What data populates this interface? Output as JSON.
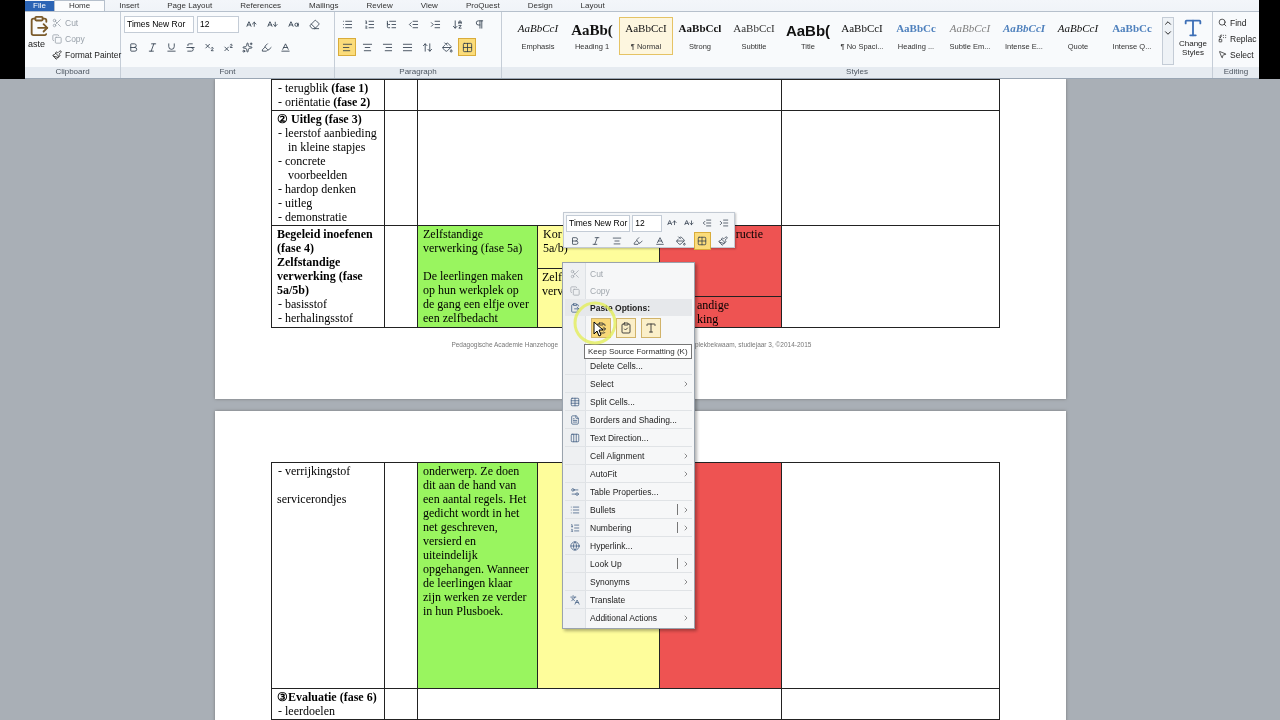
{
  "ribbon": {
    "tabs": [
      {
        "label": "File",
        "selected": false,
        "kind": "file"
      },
      {
        "label": "Home",
        "selected": true,
        "kind": "tab"
      },
      {
        "label": "Insert",
        "selected": false,
        "kind": "tab"
      },
      {
        "label": "Page Layout",
        "selected": false,
        "kind": "tab"
      },
      {
        "label": "References",
        "selected": false,
        "kind": "tab"
      },
      {
        "label": "Mailings",
        "selected": false,
        "kind": "tab"
      },
      {
        "label": "Review",
        "selected": false,
        "kind": "tab"
      },
      {
        "label": "View",
        "selected": false,
        "kind": "tab"
      },
      {
        "label": "ProQuest",
        "selected": false,
        "kind": "tab"
      },
      {
        "label": "Design",
        "selected": false,
        "kind": "tab"
      },
      {
        "label": "Layout",
        "selected": false,
        "kind": "tab"
      }
    ],
    "clipboard": {
      "label": "Clipboard",
      "paste": "aste",
      "items": [
        {
          "label": "Cut",
          "disabled": true
        },
        {
          "label": "Copy",
          "disabled": true
        },
        {
          "label": "Format Painter",
          "disabled": false
        }
      ]
    },
    "font": {
      "label": "Font",
      "font_name": "Times New Ror",
      "font_size": "12"
    },
    "paragraph": {
      "label": "Paragraph",
      "align_buttons": [
        {
          "selected": true
        },
        {
          "selected": false
        },
        {
          "selected": false
        },
        {
          "selected": false
        }
      ],
      "borders_active": true
    },
    "styles": {
      "label": "Styles",
      "items": [
        {
          "preview": "AaBbCcI",
          "name": "Emphasis",
          "kind": "emphasis",
          "selected": false
        },
        {
          "preview": "AaBb(",
          "name": "Heading 1",
          "kind": "heading",
          "selected": false
        },
        {
          "preview": "AaBbCcI",
          "name": "¶ Normal",
          "kind": "normal",
          "selected": true
        },
        {
          "preview": "AaBbCcl",
          "name": "Strong",
          "kind": "strong",
          "selected": false
        },
        {
          "preview": "AaBbCcI",
          "name": "Subtitle",
          "kind": "subtitle",
          "selected": false
        },
        {
          "preview": "AaBb(",
          "name": "Title",
          "kind": "title",
          "selected": false
        },
        {
          "preview": "AaBbCcI",
          "name": "¶ No Spaci...",
          "kind": "normal",
          "selected": false
        },
        {
          "preview": "AaBbCc",
          "name": "Heading ...",
          "kind": "heading2",
          "selected": false
        },
        {
          "preview": "AaBbCcI",
          "name": "Subtle Em...",
          "kind": "subtle",
          "selected": false
        },
        {
          "preview": "AaBbCcI",
          "name": "Intense E...",
          "kind": "intense",
          "selected": false
        },
        {
          "preview": "AaBbCcI",
          "name": "Quote",
          "kind": "emphasis",
          "selected": false
        },
        {
          "preview": "AaBbCc",
          "name": "Intense Q...",
          "kind": "heading2",
          "selected": false
        }
      ],
      "change_styles": [
        "Change",
        "Styles"
      ]
    },
    "editing": {
      "label": "Editing",
      "items": [
        "Find",
        "Replac",
        "Select"
      ]
    }
  },
  "pages": [
    {
      "footer": [
        "Pedagogische Academie Hanzehoge",
        "plekbekwaam, studiejaar 3, ©2014-2015"
      ],
      "rows": [
        {
          "cells": [
            {
              "paragraphs": [
                {
                  "text": "- terugblik **(fase 1)**",
                  "kind": "bullet",
                  "bold": false
                },
                {
                  "text": "- oriëntatie **(fase 2)**",
                  "kind": "bullet",
                  "bold": false
                }
              ]
            },
            {},
            {},
            {}
          ]
        },
        {
          "cells": [
            {
              "paragraphs": [
                {
                  "text": "② Uitleg (fase 3)",
                  "kind": "plain",
                  "bold": true
                },
                {
                  "text": "- leerstof aanbieding in kleine stapjes",
                  "kind": "bullet",
                  "bold": false
                },
                {
                  "text": "- concrete voorbeelden",
                  "kind": "bullet",
                  "bold": false
                },
                {
                  "text": "- hardop denken",
                  "kind": "bullet",
                  "bold": false
                },
                {
                  "text": "- uitleg",
                  "kind": "bullet",
                  "bold": false
                },
                {
                  "text": "- demonstratie",
                  "kind": "bullet",
                  "bold": false
                }
              ]
            },
            {},
            {},
            {}
          ]
        },
        {
          "cells": [
            {
              "paragraphs": [
                {
                  "text": "Begeleid inoefenen (fase 4)",
                  "kind": "plain",
                  "bold": true
                },
                {
                  "text": "Zelfstandige verwerking (fase 5a/5b)",
                  "kind": "plain",
                  "bold": true
                },
                {
                  "text": "- basisstof",
                  "kind": "bullet",
                  "bold": false
                },
                {
                  "text": "- herhalingsstof",
                  "kind": "bullet",
                  "bold": false
                }
              ]
            },
            {},
            {
              "color": "#99f55f",
              "paragraphs": [
                {
                  "text": "Zelfstandige verwerking (fase 5a)",
                  "kind": "plain",
                  "bold": false
                },
                {
                  "text": "De leerlingen maken op hun werkplek op de gang een elfje over een zelfbedacht",
                  "kind": "spaced",
                  "bold": false
                }
              ]
            },
            {
              "color": "#fefd9b",
              "parts": [
                {
                  "paragraphs": [
                    {
                      "text": "Kor",
                      "bold": false
                    },
                    {
                      "text": "5a/b)",
                      "bold": false
                    }
                  ]
                },
                {
                  "paragraphs": [
                    {
                      "text": "Zelf",
                      "bold": false
                    },
                    {
                      "text": "verv",
                      "bold": false
                    }
                  ]
                }
              ]
            },
            {
              "color": "#ee5352",
              "parts": [
                {
                  "paragraphs": [
                    {
                      "text": "ructie",
                      "bold": false
                    }
                  ]
                },
                {
                  "paragraphs": [
                    {
                      "text": "andige",
                      "bold": false
                    },
                    {
                      "text": "king",
                      "bold": false
                    }
                  ]
                }
              ]
            },
            {}
          ]
        }
      ]
    },
    {
      "rows": [
        {
          "cells": [
            {
              "paragraphs": [
                {
                  "text": "- verrijkingstof",
                  "kind": "bullet",
                  "bold": false
                },
                {
                  "text": "servicerondjes",
                  "kind": "spaced",
                  "bold": false
                }
              ]
            },
            {},
            {
              "color": "#99f55f",
              "paragraphs": [
                {
                  "text": "onderwerp. Ze doen dit aan de hand van een aantal regels. Het gedicht wordt in het net geschreven, versierd en uiteindelijk opgehangen. Wanneer de leerlingen klaar zijn werken ze verder in hun Plusboek.",
                  "kind": "plain",
                  "bold": false
                }
              ]
            },
            {
              "color": "#fefd9b"
            },
            {
              "color": "#ee5352"
            },
            {}
          ]
        },
        {
          "cells": [
            {
              "paragraphs": [
                {
                  "text": "③Evaluatie (fase 6)",
                  "kind": "plain",
                  "bold": true
                },
                {
                  "text": "- leerdoelen",
                  "kind": "bullet",
                  "bold": false
                }
              ]
            },
            {},
            {},
            {}
          ]
        }
      ]
    }
  ],
  "mini_toolbar": {
    "font_name": "Times New Ror",
    "font_size": "12",
    "borders_active": true
  },
  "context_menu": {
    "items": [
      {
        "kind": "item",
        "label": "Cut",
        "disabled": true
      },
      {
        "kind": "item",
        "label": "Copy",
        "disabled": true
      },
      {
        "kind": "header",
        "label": "Paste Options:"
      },
      {
        "kind": "paste_row",
        "buttons": [
          {
            "selected": true
          },
          {
            "selected": false
          },
          {
            "selected": false
          }
        ]
      },
      {
        "kind": "hidden"
      },
      {
        "kind": "item",
        "label": "Delete Cells...",
        "disabled": false
      },
      {
        "kind": "submenu",
        "label": "Select",
        "disabled": false
      },
      {
        "kind": "item",
        "label": "Split Cells...",
        "disabled": false
      },
      {
        "kind": "item",
        "label": "Borders and Shading...",
        "disabled": false
      },
      {
        "kind": "item",
        "label": "Text Direction...",
        "disabled": false
      },
      {
        "kind": "submenu",
        "label": "Cell Alignment",
        "disabled": false
      },
      {
        "kind": "submenu",
        "label": "AutoFit",
        "disabled": false
      },
      {
        "kind": "item",
        "label": "Table Properties...",
        "disabled": false
      },
      {
        "kind": "split",
        "label": "Bullets",
        "disabled": false
      },
      {
        "kind": "split",
        "label": "Numbering",
        "disabled": false
      },
      {
        "kind": "item",
        "label": "Hyperlink...",
        "disabled": false
      },
      {
        "kind": "split",
        "label": "Look Up",
        "disabled": false
      },
      {
        "kind": "submenu",
        "label": "Synonyms",
        "disabled": false
      },
      {
        "kind": "item",
        "label": "Translate",
        "disabled": false
      },
      {
        "kind": "submenu",
        "label": "Additional Actions",
        "disabled": false
      }
    ],
    "tooltip": "Keep Source Formatting (K)"
  }
}
